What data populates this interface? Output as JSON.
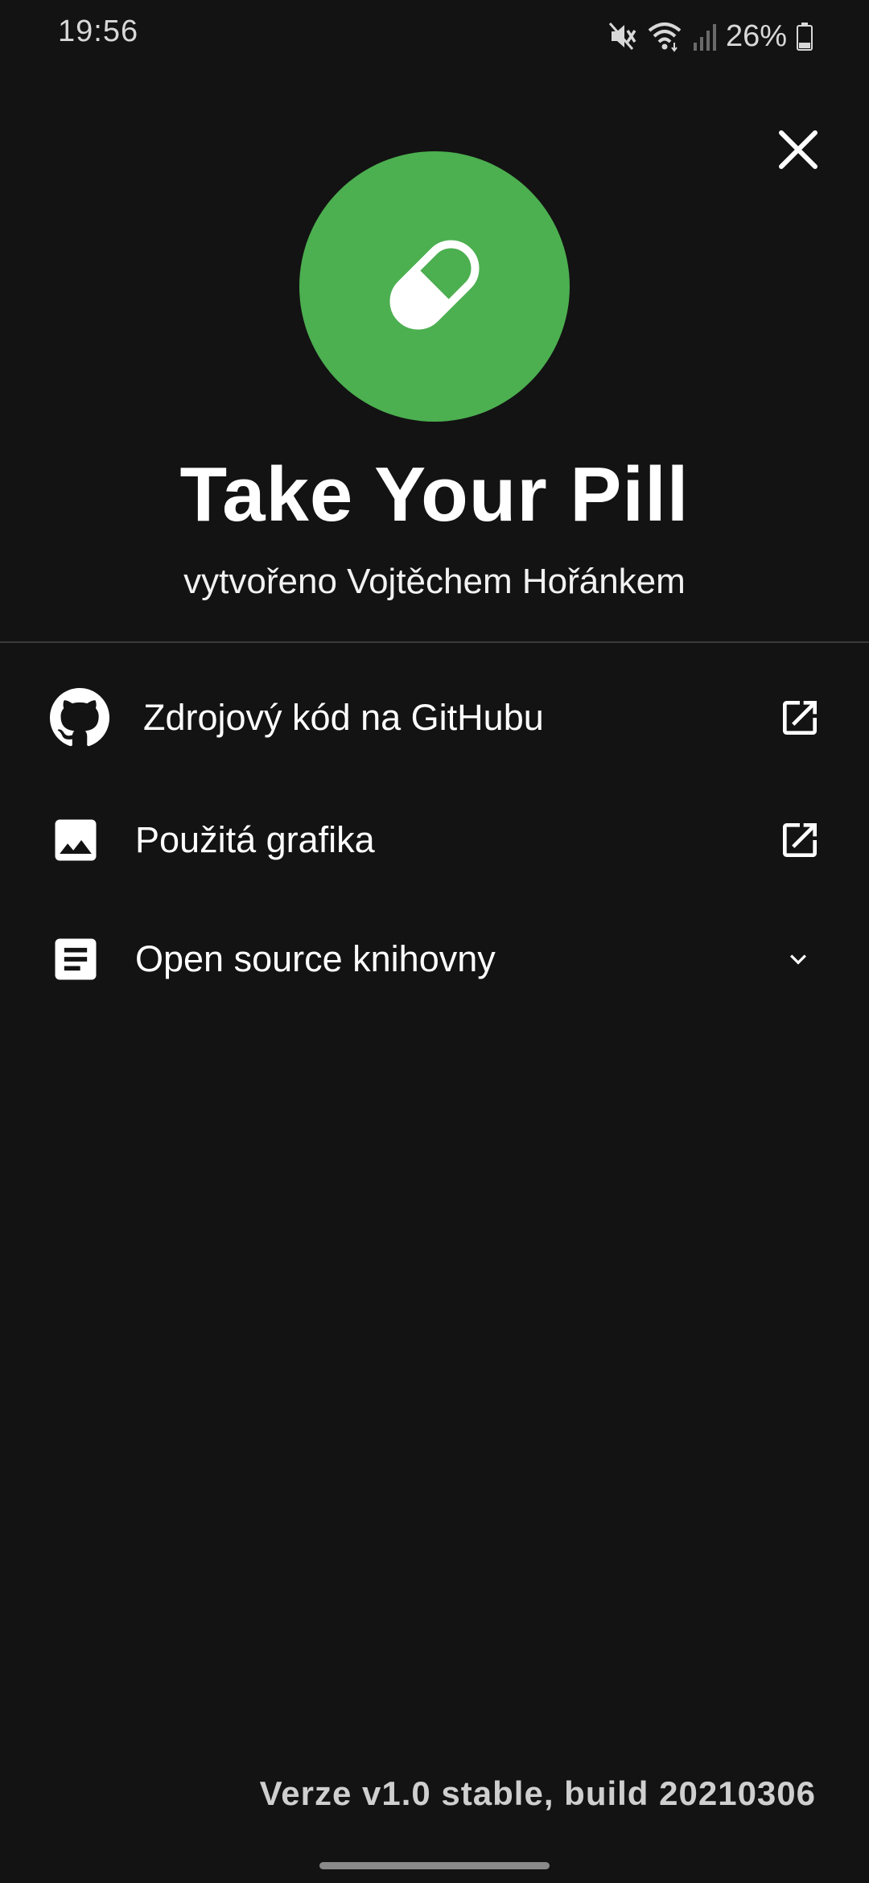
{
  "status_bar": {
    "time": "19:56",
    "battery": "26%",
    "icons": [
      "mute-icon",
      "wifi-icon",
      "signal-icon",
      "battery-icon"
    ]
  },
  "header": {
    "close_icon": "close-icon",
    "logo_icon": "pill-icon",
    "logo_color": "#4caf50",
    "title": "Take Your Pill",
    "author": "vytvořeno Vojtěchem Hořánkem"
  },
  "list": {
    "items": [
      {
        "label": "Zdrojový kód na GitHubu",
        "icon": "github-icon",
        "trailing": "open-in-new-icon"
      },
      {
        "label": "Použitá grafika",
        "icon": "image-icon",
        "trailing": "open-in-new-icon"
      },
      {
        "label": "Open source knihovny",
        "icon": "document-icon",
        "trailing": "chevron-down-icon"
      }
    ]
  },
  "footer": {
    "version": "Verze v1.0 stable, build 20210306"
  }
}
